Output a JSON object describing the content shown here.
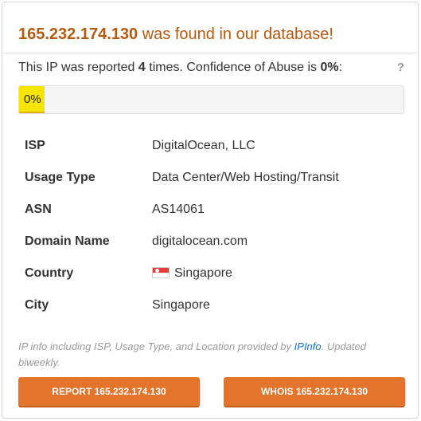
{
  "header": {
    "ip": "165.232.174.130",
    "title_suffix": " was found in our database!"
  },
  "report": {
    "prefix": "This IP was reported ",
    "count": "4",
    "middle": " times. Confidence of Abuse is ",
    "confidence": "0%",
    "suffix": ":",
    "help": "?"
  },
  "confidence_bar": {
    "value": 0,
    "label": "0%",
    "fill_color": "#f5e400"
  },
  "info": {
    "isp": {
      "key": "ISP",
      "value": "DigitalOcean, LLC"
    },
    "usage_type": {
      "key": "Usage Type",
      "value": "Data Center/Web Hosting/Transit"
    },
    "asn": {
      "key": "ASN",
      "value": "AS14061"
    },
    "domain": {
      "key": "Domain Name",
      "value": "digitalocean.com"
    },
    "country": {
      "key": "Country",
      "value": "Singapore",
      "flag_icon": "singapore-flag-icon"
    },
    "city": {
      "key": "City",
      "value": "Singapore"
    }
  },
  "note": {
    "prefix": "IP info including ISP, Usage Type, and Location provided by ",
    "link": "IPInfo",
    "suffix": ". Updated biweekly."
  },
  "buttons": {
    "report": "REPORT 165.232.174.130",
    "whois": "WHOIS 165.232.174.130"
  },
  "colors": {
    "accent": "#e2742c",
    "title": "#b35a11",
    "link": "#1a73c7"
  }
}
